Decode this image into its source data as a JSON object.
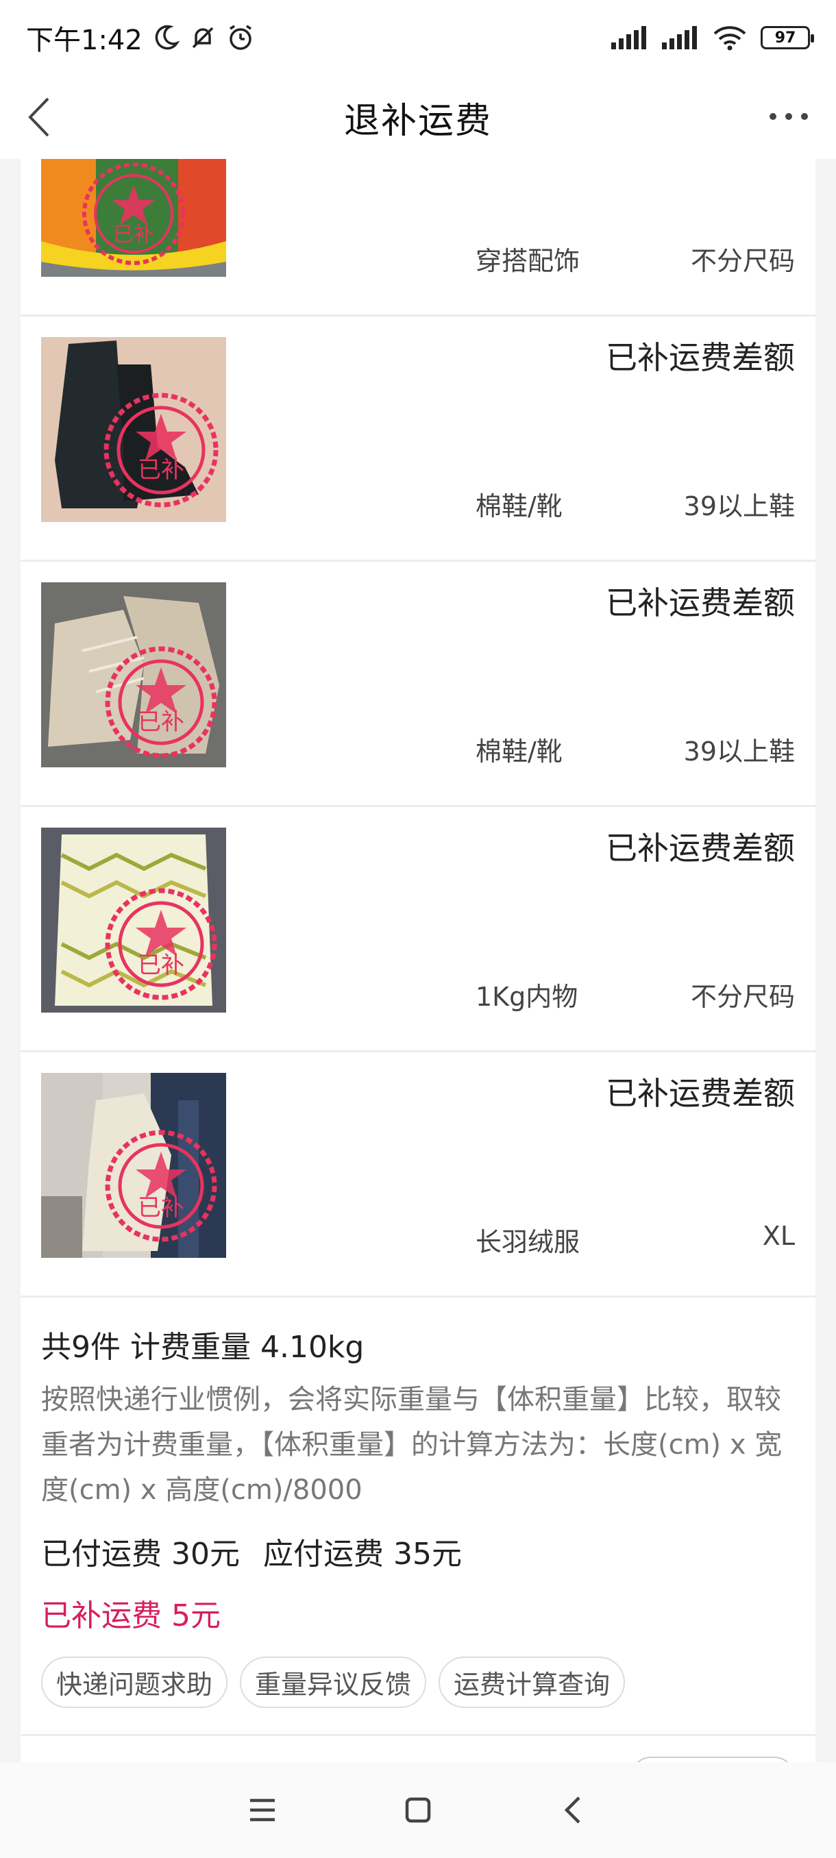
{
  "status_bar": {
    "time": "下午1:42",
    "battery": "97"
  },
  "nav": {
    "title": "退补运费"
  },
  "items": [
    {
      "status": "",
      "category": "穿搭配饰",
      "size": "不分尺码",
      "stamp": "已补"
    },
    {
      "status": "已补运费差额",
      "category": "棉鞋/靴",
      "size": "39以上鞋",
      "stamp": "已补"
    },
    {
      "status": "已补运费差额",
      "category": "棉鞋/靴",
      "size": "39以上鞋",
      "stamp": "已补"
    },
    {
      "status": "已补运费差额",
      "category": "1Kg内物",
      "size": "不分尺码",
      "stamp": "已补"
    },
    {
      "status": "已补运费差额",
      "category": "长羽绒服",
      "size": "XL",
      "stamp": "已补"
    }
  ],
  "summary": {
    "title": "共9件 计费重量 4.10kg",
    "description": "按照快递行业惯例，会将实际重量与【体积重量】比较，取较重者为计费重量，【体积重量】的计算方法为：长度(cm) x 宽度(cm) x 高度(cm)/8000",
    "paid_fee": "已付运费 30元",
    "due_fee": "应付运费 35元",
    "extra_fee": "已补运费 5元",
    "tags": [
      "快递问题求助",
      "重量异议反馈",
      "运费计算查询"
    ]
  },
  "colors": {
    "accent": "#d81e5b",
    "stamp": "#e8335f"
  }
}
